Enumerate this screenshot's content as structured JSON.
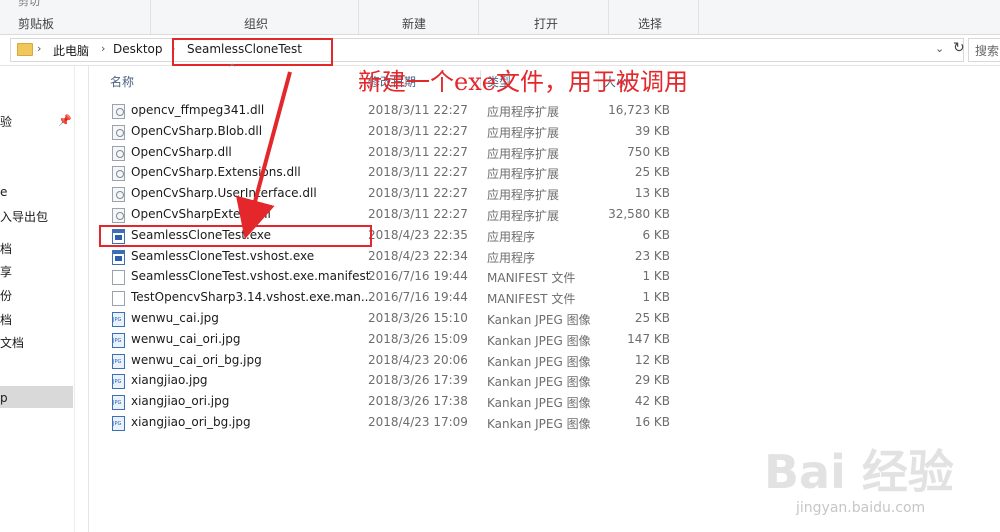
{
  "ribbon": {
    "cut_label": "剪切",
    "groups": [
      "剪贴板",
      "组织",
      "新建",
      "打开",
      "选择"
    ]
  },
  "address": {
    "crumbs": [
      "此电脑",
      "Desktop",
      "SeamlessCloneTest"
    ],
    "refresh_icon": "refresh-icon",
    "search_label": "搜索"
  },
  "nav": {
    "items": [
      "验",
      "",
      "e",
      "入导出包",
      "档",
      "享",
      "份",
      "档",
      "文档",
      "p"
    ],
    "selected_index": 9
  },
  "columns": {
    "name": "名称",
    "date": "修改日期",
    "type": "类型",
    "size": "大小"
  },
  "files": [
    {
      "name": "opencv_ffmpeg341.dll",
      "date": "2018/3/11 22:27",
      "type": "应用程序扩展",
      "size": "16,723 KB",
      "icon": "dll"
    },
    {
      "name": "OpenCvSharp.Blob.dll",
      "date": "2018/3/11 22:27",
      "type": "应用程序扩展",
      "size": "39 KB",
      "icon": "dll"
    },
    {
      "name": "OpenCvSharp.dll",
      "date": "2018/3/11 22:27",
      "type": "应用程序扩展",
      "size": "750 KB",
      "icon": "dll"
    },
    {
      "name": "OpenCvSharp.Extensions.dll",
      "date": "2018/3/11 22:27",
      "type": "应用程序扩展",
      "size": "25 KB",
      "icon": "dll"
    },
    {
      "name": "OpenCvSharp.UserInterface.dll",
      "date": "2018/3/11 22:27",
      "type": "应用程序扩展",
      "size": "13 KB",
      "icon": "dll"
    },
    {
      "name": "OpenCvSharpExtern.dll",
      "date": "2018/3/11 22:27",
      "type": "应用程序扩展",
      "size": "32,580 KB",
      "icon": "dll"
    },
    {
      "name": "SeamlessCloneTest.exe",
      "date": "2018/4/23 22:35",
      "type": "应用程序",
      "size": "6 KB",
      "icon": "exe"
    },
    {
      "name": "SeamlessCloneTest.vshost.exe",
      "date": "2018/4/23 22:34",
      "type": "应用程序",
      "size": "23 KB",
      "icon": "exe"
    },
    {
      "name": "SeamlessCloneTest.vshost.exe.manifest",
      "date": "2016/7/16 19:44",
      "type": "MANIFEST 文件",
      "size": "1 KB",
      "icon": "file"
    },
    {
      "name": "TestOpencvSharp3.14.vshost.exe.man...",
      "date": "2016/7/16 19:44",
      "type": "MANIFEST 文件",
      "size": "1 KB",
      "icon": "file"
    },
    {
      "name": "wenwu_cai.jpg",
      "date": "2018/3/26 15:10",
      "type": "Kankan JPEG 图像",
      "size": "25 KB",
      "icon": "jpg"
    },
    {
      "name": "wenwu_cai_ori.jpg",
      "date": "2018/3/26 15:09",
      "type": "Kankan JPEG 图像",
      "size": "147 KB",
      "icon": "jpg"
    },
    {
      "name": "wenwu_cai_ori_bg.jpg",
      "date": "2018/4/23 20:06",
      "type": "Kankan JPEG 图像",
      "size": "12 KB",
      "icon": "jpg"
    },
    {
      "name": "xiangjiao.jpg",
      "date": "2018/3/26 17:39",
      "type": "Kankan JPEG 图像",
      "size": "29 KB",
      "icon": "jpg"
    },
    {
      "name": "xiangjiao_ori.jpg",
      "date": "2018/3/26 17:38",
      "type": "Kankan JPEG 图像",
      "size": "42 KB",
      "icon": "jpg"
    },
    {
      "name": "xiangjiao_ori_bg.jpg",
      "date": "2018/4/23 17:09",
      "type": "Kankan JPEG 图像",
      "size": "16 KB",
      "icon": "jpg"
    }
  ],
  "annotation": {
    "text": "新建一个exe文件，用于被调用",
    "color": "#e3272b"
  },
  "watermark": {
    "brand": "Bai 经验",
    "url": "jingyan.baidu.com"
  }
}
